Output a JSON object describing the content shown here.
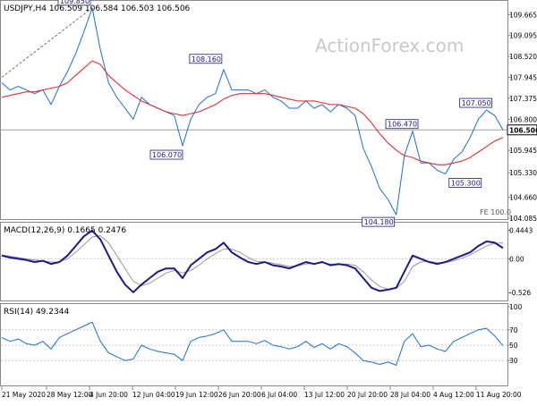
{
  "chart_data": [
    {
      "type": "line",
      "panel": "price",
      "title": "USDJPY,H4  106.509 106.584 106.503 106.506",
      "watermark": "ActionForex.com",
      "xlabel": "",
      "ylabel": "",
      "ylim": [
        104.085,
        109.92
      ],
      "yticks": [
        "109.665",
        "109.095",
        "108.520",
        "107.945",
        "107.375",
        "106.800",
        "106.506",
        "105.945",
        "105.330",
        "104.660",
        "104.085"
      ],
      "last_price": "106.506",
      "last_price_value": 106.506,
      "horizontal_line": 106.506,
      "x": [
        "21 May 2020",
        "28 May 12:00",
        "4 Jun 20:00",
        "12 Jun 04:00",
        "19 Jun 12:00",
        "26 Jun 20:00",
        "6 Jul 04:00",
        "13 Jul 12:00",
        "20 Jul 20:00",
        "28 Jul 04:00",
        "4 Aug 12:00",
        "11 Aug 20:00"
      ],
      "series": [
        {
          "color": "#1a6fd1",
          "values": [
            107.8,
            107.6,
            107.7,
            107.6,
            107.5,
            107.6,
            107.2,
            107.7,
            108.1,
            108.6,
            109.2,
            109.85,
            108.7,
            107.8,
            107.4,
            107.1,
            106.8,
            107.4,
            107.2,
            107.1,
            107.0,
            106.9,
            106.07,
            106.8,
            107.2,
            107.4,
            107.5,
            108.16,
            107.6,
            107.6,
            107.6,
            107.5,
            107.6,
            107.4,
            107.3,
            107.1,
            107.1,
            107.3,
            107.1,
            107.2,
            107.0,
            107.2,
            107.1,
            106.9,
            106.0,
            105.5,
            104.9,
            104.6,
            104.18,
            105.8,
            106.47,
            105.6,
            105.6,
            105.4,
            105.3,
            105.7,
            105.9,
            106.3,
            106.8,
            107.05,
            106.9,
            106.506
          ]
        },
        {
          "color": "#e03030",
          "values": [
            107.4,
            107.45,
            107.5,
            107.55,
            107.55,
            107.6,
            107.65,
            107.7,
            107.8,
            108.0,
            108.2,
            108.4,
            108.3,
            108.0,
            107.8,
            107.6,
            107.45,
            107.3,
            107.2,
            107.1,
            107.0,
            106.95,
            106.9,
            106.95,
            107.0,
            107.1,
            107.2,
            107.35,
            107.45,
            107.5,
            107.5,
            107.5,
            107.5,
            107.45,
            107.4,
            107.35,
            107.3,
            107.3,
            107.3,
            107.25,
            107.2,
            107.2,
            107.15,
            107.1,
            106.95,
            106.7,
            106.4,
            106.15,
            105.95,
            105.8,
            105.75,
            105.65,
            105.6,
            105.55,
            105.55,
            105.6,
            105.65,
            105.75,
            105.9,
            106.05,
            106.2,
            106.3
          ]
        }
      ],
      "annotations": [
        {
          "label": "109.850",
          "value": 109.85
        },
        {
          "label": "108.160",
          "value": 108.16
        },
        {
          "label": "106.070",
          "value": 106.07
        },
        {
          "label": "106.470",
          "value": 106.47
        },
        {
          "label": "105.300",
          "value": 105.3
        },
        {
          "label": "104.180",
          "value": 104.18
        },
        {
          "label": "107.050",
          "value": 107.05
        }
      ],
      "fe_label": "FE 100.0"
    },
    {
      "type": "line",
      "panel": "macd",
      "title": "MACD(12,26,9) 0.1665 0.2476",
      "ylim": [
        -0.62,
        0.52
      ],
      "yticks": [
        "0.4443",
        "0.00",
        "-0.526"
      ],
      "series": [
        {
          "color": "#1a1a8a",
          "values": [
            0.05,
            0.02,
            0.0,
            -0.02,
            -0.05,
            -0.03,
            -0.08,
            -0.05,
            0.05,
            0.2,
            0.35,
            0.44,
            0.3,
            0.05,
            -0.2,
            -0.4,
            -0.52,
            -0.4,
            -0.3,
            -0.2,
            -0.15,
            -0.15,
            -0.3,
            -0.1,
            0.0,
            0.1,
            0.15,
            0.25,
            0.1,
            0.02,
            -0.05,
            -0.08,
            -0.05,
            -0.1,
            -0.12,
            -0.15,
            -0.1,
            -0.05,
            -0.08,
            -0.05,
            -0.1,
            -0.08,
            -0.1,
            -0.15,
            -0.3,
            -0.45,
            -0.5,
            -0.48,
            -0.45,
            -0.2,
            0.05,
            0.0,
            -0.05,
            -0.08,
            -0.05,
            0.0,
            0.05,
            0.1,
            0.2,
            0.27,
            0.25,
            0.1665
          ]
        },
        {
          "color": "#999999",
          "values": [
            0.06,
            0.04,
            0.02,
            0.0,
            -0.02,
            -0.03,
            -0.05,
            -0.05,
            0.0,
            0.1,
            0.22,
            0.34,
            0.36,
            0.25,
            0.05,
            -0.15,
            -0.35,
            -0.42,
            -0.38,
            -0.3,
            -0.22,
            -0.18,
            -0.22,
            -0.18,
            -0.1,
            0.0,
            0.08,
            0.15,
            0.15,
            0.1,
            0.02,
            -0.04,
            -0.05,
            -0.07,
            -0.09,
            -0.12,
            -0.11,
            -0.08,
            -0.07,
            -0.06,
            -0.08,
            -0.08,
            -0.08,
            -0.1,
            -0.2,
            -0.33,
            -0.43,
            -0.47,
            -0.46,
            -0.35,
            -0.12,
            -0.05,
            -0.04,
            -0.06,
            -0.06,
            -0.03,
            0.01,
            0.06,
            0.13,
            0.2,
            0.24,
            0.2476
          ]
        }
      ]
    },
    {
      "type": "line",
      "panel": "rsi",
      "title": "RSI(14) 49.2344",
      "ylim": [
        0,
        100
      ],
      "yticks": [
        "100",
        "70",
        "50",
        "30",
        "0"
      ],
      "levels": [
        70,
        50,
        30
      ],
      "series": [
        {
          "color": "#1a6fd1",
          "values": [
            60,
            55,
            58,
            52,
            50,
            55,
            45,
            60,
            65,
            70,
            75,
            80,
            55,
            40,
            35,
            30,
            32,
            50,
            45,
            42,
            40,
            38,
            30,
            55,
            60,
            62,
            65,
            70,
            55,
            55,
            55,
            52,
            56,
            50,
            48,
            45,
            48,
            55,
            47,
            52,
            45,
            52,
            48,
            40,
            30,
            28,
            25,
            28,
            24,
            55,
            65,
            48,
            50,
            45,
            42,
            55,
            60,
            65,
            70,
            72,
            62,
            49.2344
          ]
        }
      ]
    }
  ]
}
